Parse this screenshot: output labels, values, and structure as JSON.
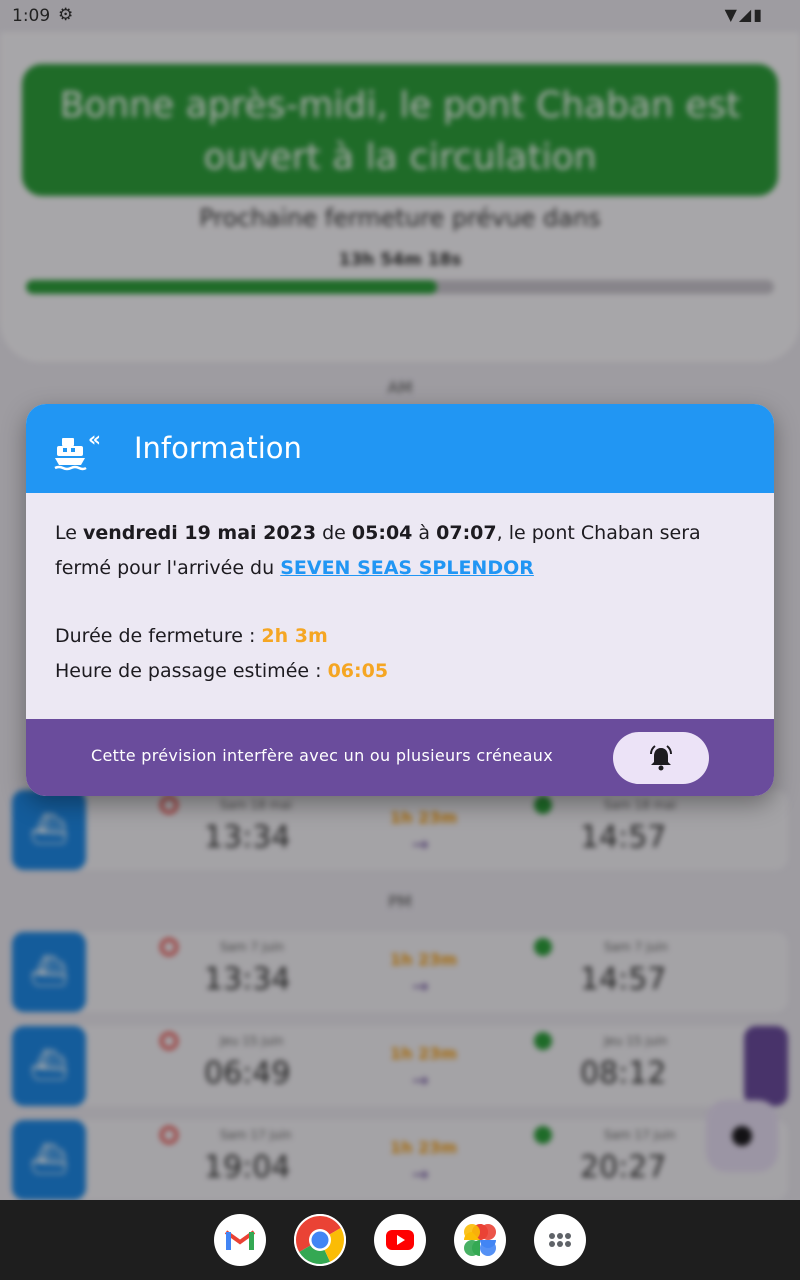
{
  "status_bar": {
    "time": "1:09"
  },
  "background": {
    "banner_text": "Bonne après-midi, le pont Chaban est ouvert à la circulation",
    "next_closure_label": "Prochaine fermeture prévue dans",
    "countdown": "13h 54m 18s",
    "progress_fraction": 0.55,
    "section_am": "AM",
    "section_pm": "PM",
    "rows": [
      {
        "date1": "Sam 18 mai",
        "start": "13:34",
        "duration": "1h 23m",
        "date2": "Sam 18 mai",
        "end": "14:57"
      },
      {
        "date1": "Sam 7 juin",
        "start": "13:34",
        "duration": "1h 23m",
        "date2": "Sam 7 juin",
        "end": "14:57"
      },
      {
        "date1": "Jeu 15 juin",
        "start": "06:49",
        "duration": "1h 23m",
        "date2": "Jeu 15 juin",
        "end": "08:12"
      },
      {
        "date1": "Sam 17 juin",
        "start": "19:04",
        "duration": "1h 23m",
        "date2": "Sam 17 juin",
        "end": "20:27"
      }
    ]
  },
  "dialog": {
    "title": "Information",
    "body": {
      "prefix": "Le ",
      "date": "vendredi 19 mai 2023",
      "de": " de ",
      "start": "05:04",
      "a": " à ",
      "end": "07:07",
      "middle": ", le pont Chaban sera fermé pour l'arrivée du ",
      "ship": "SEVEN SEAS SPLENDOR",
      "duration_label": "Durée de fermeture : ",
      "duration_value": "2h 3m",
      "passage_label": "Heure de passage estimée : ",
      "passage_value": "06:05"
    },
    "footer_text": "Cette prévision interfère avec un ou plusieurs créneaux"
  },
  "taskbar": {
    "apps": [
      "Gmail",
      "Chrome",
      "YouTube",
      "Photos",
      "App drawer"
    ]
  },
  "colors": {
    "header": "#2196f3",
    "footer": "#6a4c9c",
    "accent": "#f5a623",
    "banner": "#2e9e3c"
  }
}
